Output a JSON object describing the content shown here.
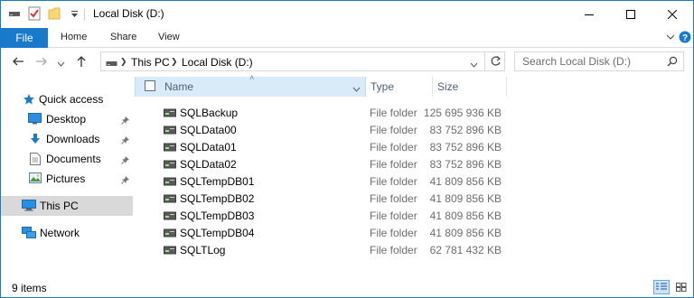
{
  "window": {
    "title": "Local Disk (D:)",
    "accent_color": "#1979ca"
  },
  "quick_access_toolbar": {
    "icons": [
      "drive-icon",
      "properties-icon",
      "new-folder-icon",
      "customize-dropdown-icon"
    ]
  },
  "ribbon": {
    "tabs": [
      "File",
      "Home",
      "Share",
      "View"
    ],
    "expand_icon": "chevron-down-icon",
    "help_icon": "help-icon"
  },
  "address_bar": {
    "breadcrumb": [
      "This PC",
      "Local Disk (D:)"
    ],
    "refresh_icon": "refresh-icon"
  },
  "search": {
    "placeholder": "Search Local Disk (D:)"
  },
  "nav_pane": {
    "quick_access": "Quick access",
    "items": [
      {
        "label": "Desktop",
        "icon": "desktop-icon",
        "pinned": true
      },
      {
        "label": "Downloads",
        "icon": "downloads-icon",
        "pinned": true
      },
      {
        "label": "Documents",
        "icon": "documents-icon",
        "pinned": true
      },
      {
        "label": "Pictures",
        "icon": "pictures-icon",
        "pinned": true
      }
    ],
    "this_pc": "This PC",
    "network": "Network"
  },
  "file_list": {
    "columns": [
      "Name",
      "Type",
      "Size"
    ],
    "rows": [
      {
        "name": "SQLBackup",
        "type": "File folder",
        "size": "125 695 936 KB"
      },
      {
        "name": "SQLData00",
        "type": "File folder",
        "size": "83 752 896 KB"
      },
      {
        "name": "SQLData01",
        "type": "File folder",
        "size": "83 752 896 KB"
      },
      {
        "name": "SQLData02",
        "type": "File folder",
        "size": "83 752 896 KB"
      },
      {
        "name": "SQLTempDB01",
        "type": "File folder",
        "size": "41 809 856 KB"
      },
      {
        "name": "SQLTempDB02",
        "type": "File folder",
        "size": "41 809 856 KB"
      },
      {
        "name": "SQLTempDB03",
        "type": "File folder",
        "size": "41 809 856 KB"
      },
      {
        "name": "SQLTempDB04",
        "type": "File folder",
        "size": "41 809 856 KB"
      },
      {
        "name": "SQLTLog",
        "type": "File folder",
        "size": "62 781 432 KB"
      }
    ]
  },
  "status_bar": {
    "item_count": "9 items",
    "view_modes": [
      "details-view-icon",
      "large-icons-view-icon"
    ]
  }
}
